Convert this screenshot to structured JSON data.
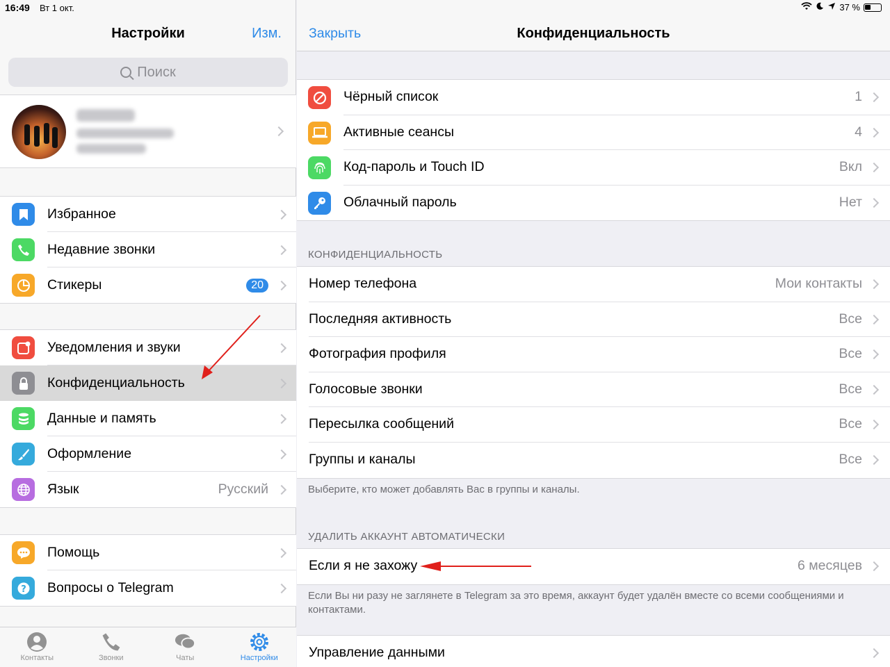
{
  "status_bar": {
    "time": "16:49",
    "date": "Вт 1 окт.",
    "battery": "37 %"
  },
  "left": {
    "title": "Настройки",
    "edit": "Изм.",
    "search_placeholder": "Поиск",
    "group1": [
      {
        "label": "Избранное",
        "icon": "bookmark-icon",
        "color": "#2f8be8"
      },
      {
        "label": "Недавние звонки",
        "icon": "phone-icon",
        "color": "#4cd964"
      },
      {
        "label": "Стикеры",
        "icon": "sticker-icon",
        "color": "#f7a829",
        "badge": "20"
      }
    ],
    "group2": [
      {
        "label": "Уведомления и звуки",
        "icon": "notification-icon",
        "color": "#f04d3f"
      },
      {
        "label": "Конфиденциальность",
        "icon": "lock-icon",
        "color": "#8e8e93"
      },
      {
        "label": "Данные и память",
        "icon": "database-icon",
        "color": "#4cd964"
      },
      {
        "label": "Оформление",
        "icon": "brush-icon",
        "color": "#35aadc"
      },
      {
        "label": "Язык",
        "icon": "globe-icon",
        "color": "#b76de0",
        "value": "Русский"
      }
    ],
    "group3": [
      {
        "label": "Помощь",
        "icon": "chat-bubble-icon",
        "color": "#f7a829"
      },
      {
        "label": "Вопросы о Telegram",
        "icon": "question-icon",
        "color": "#35aadc"
      }
    ],
    "tabs": [
      {
        "label": "Контакты",
        "icon": "contacts-icon"
      },
      {
        "label": "Звонки",
        "icon": "phone-icon"
      },
      {
        "label": "Чаты",
        "icon": "chats-icon"
      },
      {
        "label": "Настройки",
        "icon": "settings-gear-icon"
      }
    ]
  },
  "right": {
    "close": "Закрыть",
    "title": "Конфиденциальность",
    "security": [
      {
        "label": "Чёрный список",
        "value": "1",
        "icon": "block-icon",
        "color": "#f04d3f"
      },
      {
        "label": "Активные сеансы",
        "value": "4",
        "icon": "laptop-icon",
        "color": "#f7a829"
      },
      {
        "label": "Код-пароль и Touch ID",
        "value": "Вкл",
        "icon": "fingerprint-icon",
        "color": "#4cd964"
      },
      {
        "label": "Облачный пароль",
        "value": "Нет",
        "icon": "key-icon",
        "color": "#2f8be8"
      }
    ],
    "privacy_header": "КОНФИДЕНЦИАЛЬНОСТЬ",
    "privacy": [
      {
        "label": "Номер телефона",
        "value": "Мои контакты"
      },
      {
        "label": "Последняя активность",
        "value": "Все"
      },
      {
        "label": "Фотография профиля",
        "value": "Все"
      },
      {
        "label": "Голосовые звонки",
        "value": "Все"
      },
      {
        "label": "Пересылка сообщений",
        "value": "Все"
      },
      {
        "label": "Группы и каналы",
        "value": "Все"
      }
    ],
    "privacy_footer": "Выберите, кто может добавлять Вас в группы и каналы.",
    "delete_header": "УДАЛИТЬ АККАУНТ АВТОМАТИЧЕСКИ",
    "delete_row": {
      "label": "Если я не захожу",
      "value": "6 месяцев"
    },
    "delete_footer": "Если Вы ни разу не заглянете в Telegram за это время, аккаунт будет удалён вместе со всеми сообщениями и контактами.",
    "data_row": {
      "label": "Управление данными"
    }
  },
  "colors": {
    "accent": "#2f8be8",
    "annotation_arrow": "#e0201b"
  }
}
